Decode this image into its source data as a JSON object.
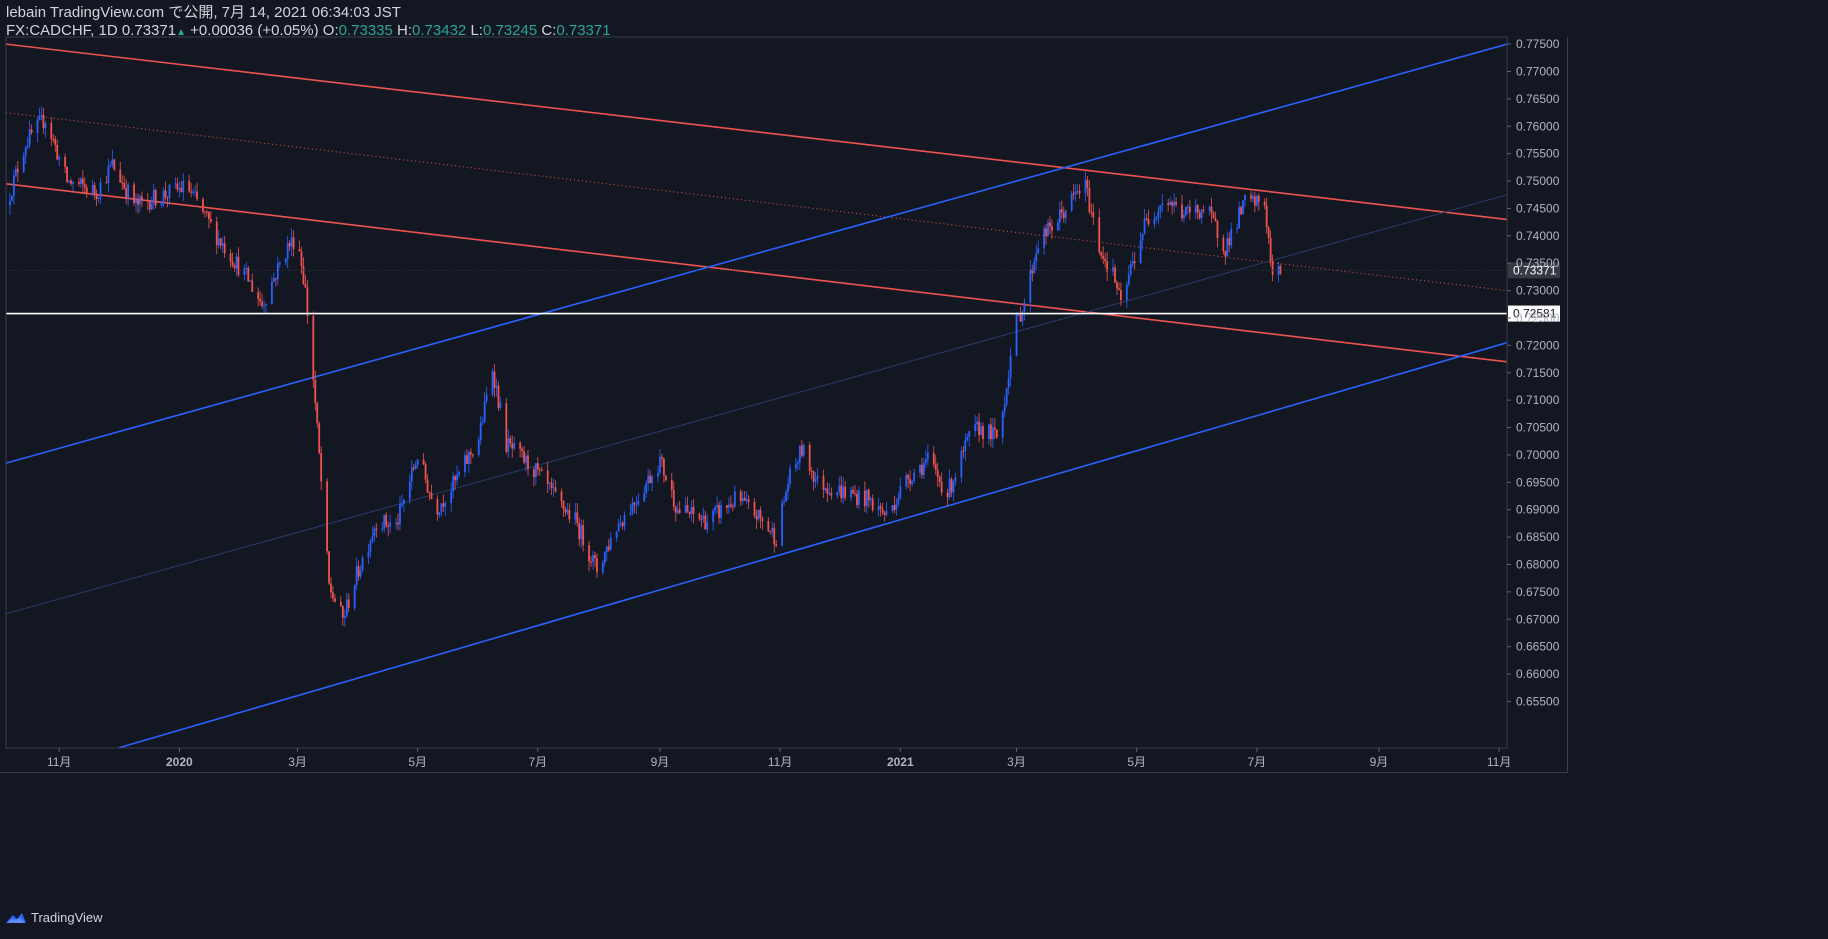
{
  "header": {
    "line1": "lebain TradingView.com で公開, 7月 14, 2021 06:34:03 JST",
    "symbol": "FX:CADCHF, 1D",
    "price": "0.73371",
    "change": "+0.00036 (+0.05%)",
    "o_label": "O:",
    "o_value": "0.73335",
    "h_label": "H:",
    "h_value": "0.73432",
    "l_label": "L:",
    "l_value": "0.73245",
    "c_label": "C:",
    "c_value": "0.73371"
  },
  "footer": {
    "brand": "TradingView"
  },
  "chart_data": {
    "type": "candlestick",
    "symbol": "FX:CADCHF",
    "interval": "1D",
    "x_ticks": [
      {
        "label": "11月",
        "date": "2019-11-01"
      },
      {
        "label": "2020",
        "date": "2020-01-01"
      },
      {
        "label": "3月",
        "date": "2020-03-01"
      },
      {
        "label": "5月",
        "date": "2020-05-01"
      },
      {
        "label": "7月",
        "date": "2020-07-01"
      },
      {
        "label": "9月",
        "date": "2020-09-01"
      },
      {
        "label": "11月",
        "date": "2020-11-01"
      },
      {
        "label": "2021",
        "date": "2021-01-01"
      },
      {
        "label": "3月",
        "date": "2021-03-01"
      },
      {
        "label": "5月",
        "date": "2021-05-01"
      },
      {
        "label": "7月",
        "date": "2021-07-01"
      },
      {
        "label": "9月",
        "date": "2021-09-01"
      },
      {
        "label": "11月",
        "date": "2021-11-01"
      }
    ],
    "xlim": [
      "2019-10-05",
      "2021-11-05"
    ],
    "ylim": [
      0.6465,
      0.7763
    ],
    "y_ticks": [
      "0.65500",
      "0.66000",
      "0.66500",
      "0.67000",
      "0.67500",
      "0.68000",
      "0.68500",
      "0.69000",
      "0.69500",
      "0.70000",
      "0.70500",
      "0.71000",
      "0.71500",
      "0.72000",
      "0.72500",
      "0.73000",
      "0.73500",
      "0.74000",
      "0.74500",
      "0.75000",
      "0.75500",
      "0.76000",
      "0.76500",
      "0.77000",
      "0.77500"
    ],
    "price_label": "0.73371",
    "hline_label": "0.72581",
    "hline_value": 0.72581,
    "up_color": "#2962ff",
    "down_color": "#ef5350",
    "anchors": [
      [
        "2019-10-05",
        0.7455
      ],
      [
        "2019-10-15",
        0.757
      ],
      [
        "2019-10-25",
        0.7615
      ],
      [
        "2019-11-05",
        0.75
      ],
      [
        "2019-11-20",
        0.748
      ],
      [
        "2019-11-28",
        0.753
      ],
      [
        "2019-12-10",
        0.7455
      ],
      [
        "2019-12-20",
        0.747
      ],
      [
        "2020-01-05",
        0.749
      ],
      [
        "2020-01-20",
        0.74
      ],
      [
        "2020-02-05",
        0.732
      ],
      [
        "2020-02-12",
        0.7275
      ],
      [
        "2020-02-25",
        0.738
      ],
      [
        "2020-03-01",
        0.74
      ],
      [
        "2020-03-05",
        0.73
      ],
      [
        "2020-03-09",
        0.714
      ],
      [
        "2020-03-13",
        0.695
      ],
      [
        "2020-03-17",
        0.676
      ],
      [
        "2020-03-24",
        0.67
      ],
      [
        "2020-03-31",
        0.678
      ],
      [
        "2020-04-10",
        0.688
      ],
      [
        "2020-04-20",
        0.687
      ],
      [
        "2020-05-01",
        0.7
      ],
      [
        "2020-05-10",
        0.69
      ],
      [
        "2020-05-20",
        0.695
      ],
      [
        "2020-06-01",
        0.703
      ],
      [
        "2020-06-08",
        0.716
      ],
      [
        "2020-06-15",
        0.702
      ],
      [
        "2020-06-30",
        0.697
      ],
      [
        "2020-07-10",
        0.692
      ],
      [
        "2020-07-20",
        0.688
      ],
      [
        "2020-07-31",
        0.679
      ],
      [
        "2020-08-10",
        0.687
      ],
      [
        "2020-08-20",
        0.692
      ],
      [
        "2020-09-01",
        0.699
      ],
      [
        "2020-09-10",
        0.69
      ],
      [
        "2020-09-25",
        0.688
      ],
      [
        "2020-10-10",
        0.692
      ],
      [
        "2020-10-20",
        0.689
      ],
      [
        "2020-10-30",
        0.685
      ],
      [
        "2020-11-05",
        0.695
      ],
      [
        "2020-11-12",
        0.701
      ],
      [
        "2020-11-20",
        0.695
      ],
      [
        "2020-12-05",
        0.693
      ],
      [
        "2020-12-15",
        0.692
      ],
      [
        "2020-12-25",
        0.689
      ],
      [
        "2021-01-05",
        0.696
      ],
      [
        "2021-01-15",
        0.699
      ],
      [
        "2021-01-25",
        0.693
      ],
      [
        "2021-02-05",
        0.703
      ],
      [
        "2021-02-10",
        0.705
      ],
      [
        "2021-02-20",
        0.703
      ],
      [
        "2021-02-28",
        0.723
      ],
      [
        "2021-03-05",
        0.728
      ],
      [
        "2021-03-12",
        0.739
      ],
      [
        "2021-03-20",
        0.742
      ],
      [
        "2021-04-01",
        0.748
      ],
      [
        "2021-04-05",
        0.749
      ],
      [
        "2021-04-12",
        0.738
      ],
      [
        "2021-04-20",
        0.732
      ],
      [
        "2021-04-23",
        0.727
      ],
      [
        "2021-04-28",
        0.734
      ],
      [
        "2021-05-05",
        0.742
      ],
      [
        "2021-05-15",
        0.747
      ],
      [
        "2021-05-25",
        0.744
      ],
      [
        "2021-06-05",
        0.745
      ],
      [
        "2021-06-15",
        0.738
      ],
      [
        "2021-06-25",
        0.746
      ],
      [
        "2021-07-05",
        0.746
      ],
      [
        "2021-07-07",
        0.739
      ],
      [
        "2021-07-09",
        0.732
      ],
      [
        "2021-07-13",
        0.7337
      ]
    ],
    "trendlines": [
      {
        "color": "#ef5350",
        "style": "solid",
        "p1": [
          "2019-10-05",
          0.775
        ],
        "p2": [
          "2021-11-05",
          0.743
        ]
      },
      {
        "color": "#ef5350",
        "style": "solid",
        "p1": [
          "2019-10-05",
          0.7495
        ],
        "p2": [
          "2021-11-05",
          0.717
        ]
      },
      {
        "color": "#ef5350",
        "style": "dotted",
        "p1": [
          "2019-10-05",
          0.7625
        ],
        "p2": [
          "2021-11-05",
          0.73
        ]
      },
      {
        "color": "#2962ff",
        "style": "solid",
        "p1": [
          "2019-10-05",
          0.6985
        ],
        "p2": [
          "2021-11-05",
          0.775
        ]
      },
      {
        "color": "#2962ff",
        "style": "solid",
        "p1": [
          "2019-12-01",
          0.6465
        ],
        "p2": [
          "2021-11-05",
          0.7205
        ]
      },
      {
        "color": "#2a3a6a",
        "style": "faint",
        "p1": [
          "2019-10-05",
          0.671
        ],
        "p2": [
          "2021-11-05",
          0.7475
        ]
      }
    ]
  }
}
